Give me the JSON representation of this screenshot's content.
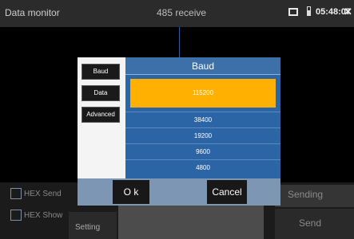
{
  "header": {
    "app_title": "Data monitor",
    "screen_title": "485 receive",
    "clock": "05:48:07",
    "icons": [
      "message-icon",
      "battery-icon",
      "close-icon"
    ]
  },
  "controls": {
    "hex_send_label": "HEX Send",
    "hex_show_label": "HEX Show",
    "setting_label": "Setting",
    "sending_label": "Sending",
    "send_label": "Send"
  },
  "dialog": {
    "tabs": [
      "Baud",
      "Data",
      "Advanced"
    ],
    "header": "Baud",
    "selected_value": "115200",
    "options": [
      "38400",
      "19200",
      "9600",
      "4800"
    ],
    "ok_label": "O k",
    "cancel_label": "Cancel"
  },
  "colors": {
    "dialog_blue": "#2f67a8",
    "selected_orange": "#ffb000"
  }
}
